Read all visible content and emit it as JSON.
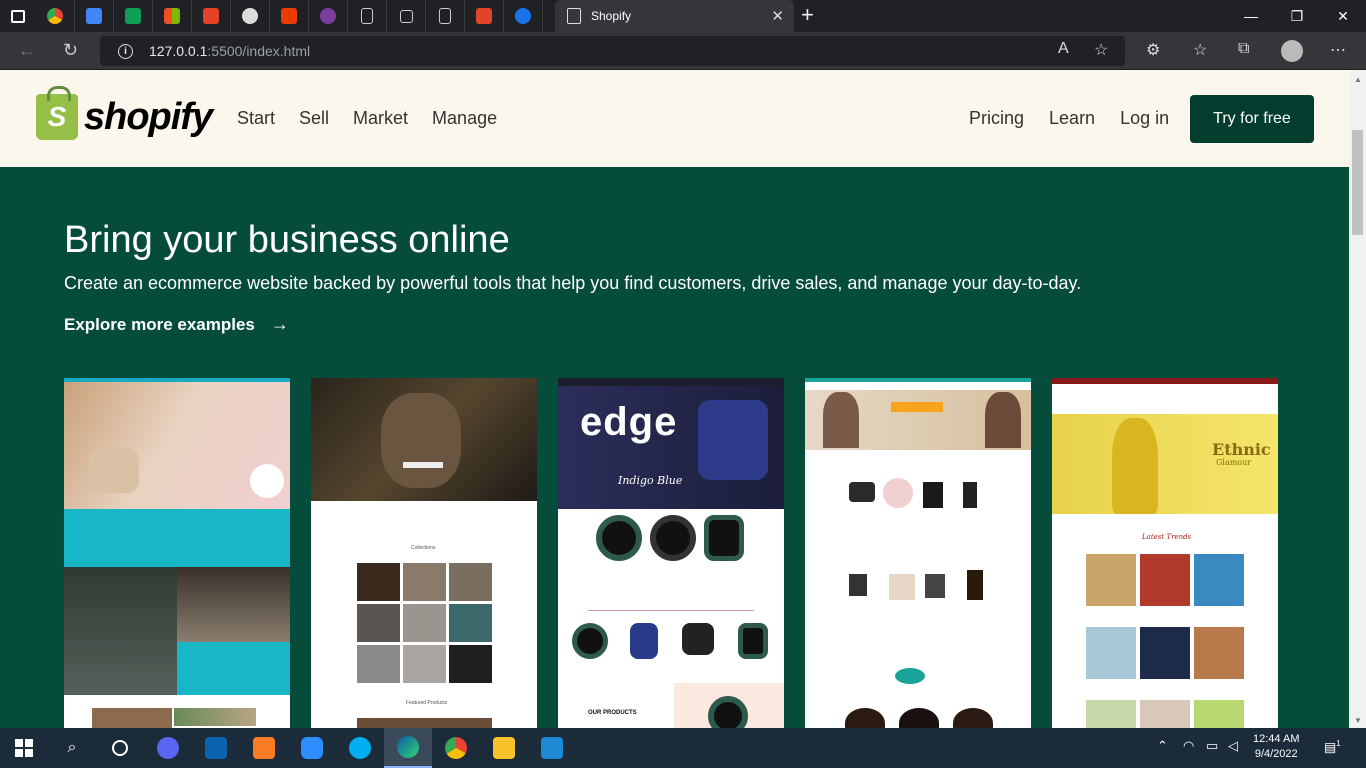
{
  "browser": {
    "tab_title": "Shopify",
    "url_host": "127.0.0.1",
    "url_rest": ":5500/index.html",
    "pinned_tab_icons": [
      "chrome-icon",
      "docs-icon",
      "sheets-icon",
      "office-icon",
      "gitlab-icon",
      "github-icon",
      "office-365-icon",
      "extension-icon",
      "page-icon",
      "square-icon",
      "page-icon",
      "gitlab-icon",
      "blue-app-icon"
    ],
    "window_controls": [
      "minimize",
      "restore",
      "close"
    ]
  },
  "header": {
    "brand": "shopify",
    "nav_left": [
      "Start",
      "Sell",
      "Market",
      "Manage"
    ],
    "nav_right": [
      "Pricing",
      "Learn",
      "Log in"
    ],
    "cta": "Try for free"
  },
  "hero": {
    "title": "Bring your business online",
    "subtitle": "Create an ecommerce website backed by powerful tools that help you find customers, drive sales, and manage your day-to-day.",
    "link": "Explore more examples",
    "link_arrow": "→"
  },
  "examples": {
    "card2_banner": "edge",
    "card2_subtitle": "Indigo Blue",
    "card2_section": "OUR PRODUCTS",
    "card4_banner": "Ethnic",
    "card4_banner2": "Glamour",
    "card4_section": "Latest Trends"
  },
  "taskbar": {
    "apps": [
      "windows-start-icon",
      "search-icon",
      "task-view-icon",
      "discord-icon",
      "outlook-icon",
      "xampp-icon",
      "zoom-icon",
      "skype-icon",
      "edge-icon",
      "chrome-icon",
      "file-explorer-icon",
      "vscode-icon"
    ],
    "time": "12:44 AM",
    "date": "9/4/2022",
    "notifications": "1"
  },
  "colors": {
    "hero_bg": "#064c3a",
    "header_bg": "#fbf7ed",
    "cta_bg": "#033d2d",
    "brand_green": "#95bf47"
  }
}
